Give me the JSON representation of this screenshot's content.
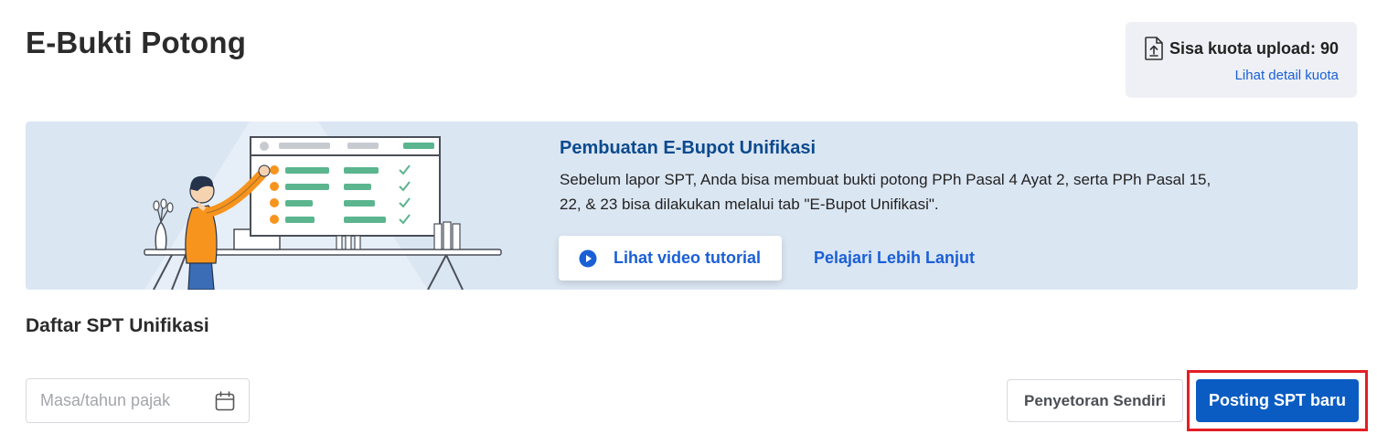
{
  "header": {
    "title": "E-Bukti Potong"
  },
  "quota": {
    "icon": "file-upload-icon",
    "label": "Sisa kuota upload: 90",
    "link": "Lihat detail kuota"
  },
  "banner": {
    "title": "Pembuatan E-Bupot Unifikasi",
    "description": "Sebelum lapor SPT, Anda bisa membuat bukti potong PPh Pasal 4 Ayat 2, serta PPh Pasal 15, 22, & 23 bisa dilakukan melalui tab \"E-Bupot Unifikasi\".",
    "video_button": "Lihat video tutorial",
    "video_icon": "play-circle-icon",
    "learn_link": "Pelajari Lebih Lanjut",
    "colors": {
      "background": "#dbe6f3",
      "title": "#0b4a8e",
      "link": "#1a5fd6"
    }
  },
  "section": {
    "title": "Daftar SPT Unifikasi"
  },
  "filters": {
    "period_placeholder": "Masa/tahun pajak",
    "period_icon": "calendar-icon"
  },
  "actions": {
    "secondary": "Penyetoran Sendiri",
    "primary": "Posting SPT baru",
    "colors": {
      "primary": "#0a5cc2",
      "highlight": "#e31e24"
    }
  }
}
